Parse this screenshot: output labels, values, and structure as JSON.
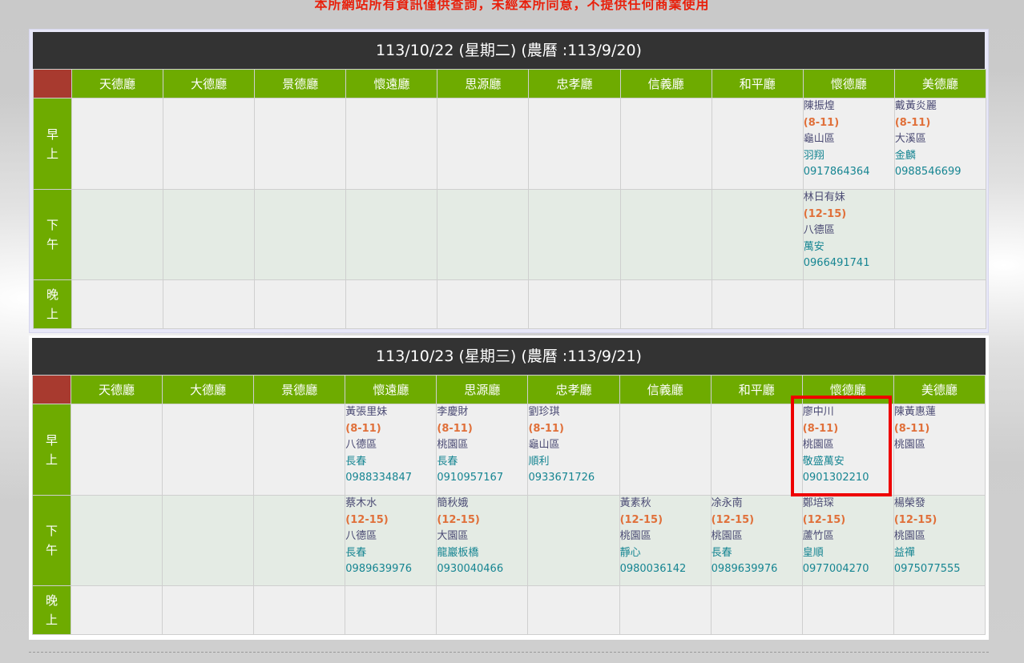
{
  "notice": "本所網站所有資訊僅供查詢，未經本所同意，不提供任何商業使用",
  "halls": [
    "天德廳",
    "大德廳",
    "景德廳",
    "懷遠廳",
    "思源廳",
    "忠孝廳",
    "信義廳",
    "和平廳",
    "懷德廳",
    "美德廳"
  ],
  "periods": {
    "morning": [
      "早",
      "上"
    ],
    "afternoon": [
      "下",
      "午"
    ],
    "evening": [
      "晚",
      "上"
    ]
  },
  "days": [
    {
      "date": "113/10/22 (星期二) (農曆 :113/9/20)",
      "entries": [
        {
          "period": "morning",
          "hall": 8,
          "name": "陳振煌",
          "time": "(8-11)",
          "district": "龜山區",
          "role": "羽翔",
          "phone": "0917864364"
        },
        {
          "period": "morning",
          "hall": 9,
          "name": "戴黃炎麗",
          "time": "(8-11)",
          "district": "大溪區",
          "role": "金麟",
          "phone": "0988546699"
        },
        {
          "period": "afternoon",
          "hall": 8,
          "name": "林日有妹",
          "time": "(12-15)",
          "district": "八德區",
          "role": "萬安",
          "phone": "0966491741"
        }
      ]
    },
    {
      "date": "113/10/23 (星期三) (農曆 :113/9/21)",
      "entries": [
        {
          "period": "morning",
          "hall": 3,
          "name": "黃張里妹",
          "time": "(8-11)",
          "district": "八德區",
          "role": "長春",
          "phone": "0988334847"
        },
        {
          "period": "morning",
          "hall": 4,
          "name": "李慶財",
          "time": "(8-11)",
          "district": "桃園區",
          "role": "長春",
          "phone": "0910957167"
        },
        {
          "period": "morning",
          "hall": 5,
          "name": "劉珍琪",
          "time": "(8-11)",
          "district": "龜山區",
          "role": "順利",
          "phone": "0933671726"
        },
        {
          "period": "morning",
          "hall": 8,
          "name": "廖中川",
          "time": "(8-11)",
          "district": "桃園區",
          "role": "敬盛萬安",
          "phone": "0901302210"
        },
        {
          "period": "morning",
          "hall": 9,
          "name": "陳黃惠蓮",
          "time": "(8-11)",
          "district": "桃園區",
          "role": "",
          "phone": ""
        },
        {
          "period": "afternoon",
          "hall": 3,
          "name": "蔡木水",
          "time": "(12-15)",
          "district": "八德區",
          "role": "長春",
          "phone": "0989639976"
        },
        {
          "period": "afternoon",
          "hall": 4,
          "name": "簡秋娥",
          "time": "(12-15)",
          "district": "大園區",
          "role": "龍巖板橋",
          "phone": "0930040466"
        },
        {
          "period": "afternoon",
          "hall": 6,
          "name": "黃素秋",
          "time": "(12-15)",
          "district": "桃園區",
          "role": "靜心",
          "phone": "0980036142"
        },
        {
          "period": "afternoon",
          "hall": 7,
          "name": "凃永南",
          "time": "(12-15)",
          "district": "桃園區",
          "role": "長春",
          "phone": "0989639976"
        },
        {
          "period": "afternoon",
          "hall": 8,
          "name": "鄭培琛",
          "time": "(12-15)",
          "district": "蘆竹區",
          "role": "皇順",
          "phone": "0977004270"
        },
        {
          "period": "afternoon",
          "hall": 9,
          "name": "楊榮發",
          "time": "(12-15)",
          "district": "桃園區",
          "role": "益禪",
          "phone": "0975077555"
        }
      ]
    }
  ]
}
